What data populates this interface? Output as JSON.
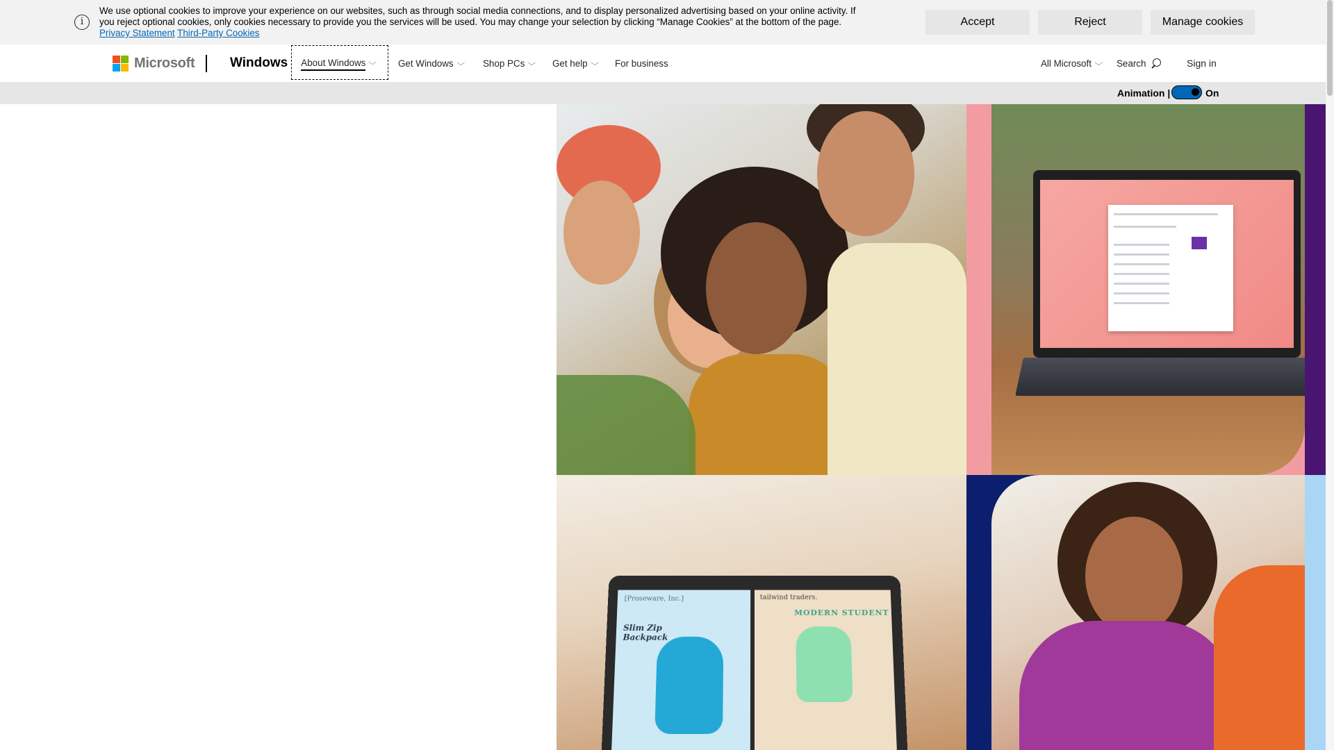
{
  "cookie_banner": {
    "text": "We use optional cookies to improve your experience on our websites, such as through social media connections, and to display personalized advertising based on your online activity. If you reject optional cookies, only cookies necessary to provide you the services will be used. You may change your selection by clicking “Manage Cookies” at the bottom of the page.",
    "privacy_link": "Privacy Statement",
    "third_party_link": "Third-Party Cookies",
    "accept_label": "Accept",
    "reject_label": "Reject",
    "manage_label": "Manage cookies",
    "info_icon": "i"
  },
  "header": {
    "logo_text": "Microsoft",
    "brand": "Windows",
    "nav": {
      "about": "About Windows",
      "get_windows": "Get Windows",
      "shop": "Shop PCs",
      "help": "Get help",
      "business": "For business"
    },
    "all_microsoft": "All Microsoft",
    "search": "Search",
    "sign_in": "Sign in",
    "chevron": "⌵"
  },
  "animation": {
    "label": "Animation |",
    "state": "On"
  },
  "hero": {
    "tablet_left_title": "Slim Zip Backpack",
    "tablet_left_search": "[Proseware, Inc.]",
    "tablet_right_title": "MODERN STUDENT",
    "tablet_right_search": "tailwind traders."
  },
  "colors": {
    "accent": "#0067b8",
    "banner_bg": "#f2f2f2",
    "anim_bar_bg": "#e6e6e6"
  }
}
